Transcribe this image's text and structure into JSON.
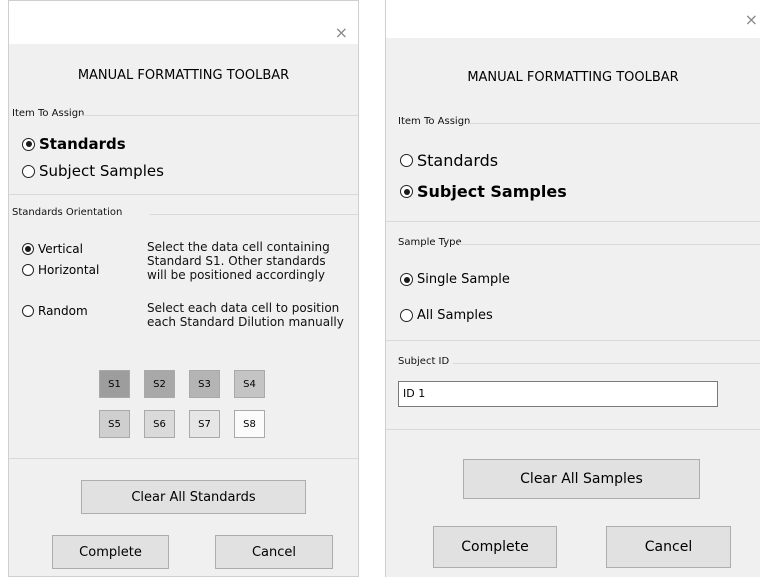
{
  "close_glyph": "×",
  "left": {
    "title": "MANUAL FORMATTING TOOLBAR",
    "item_group_label": "Item To Assign",
    "item_options": [
      {
        "label": "Standards",
        "selected": true
      },
      {
        "label": "Subject Samples",
        "selected": false
      }
    ],
    "orientation_group_label": "Standards Orientation",
    "orientation_options": [
      {
        "label": "Vertical",
        "selected": true
      },
      {
        "label": "Horizontal",
        "selected": false
      },
      {
        "label": "Random",
        "selected": false
      }
    ],
    "orientation_desc_1": [
      "Select the data cell containing",
      "Standard S1. Other standards",
      "will be positioned accordingly"
    ],
    "orientation_desc_2": [
      "Select each data cell to position",
      "each Standard Dilution manually"
    ],
    "standards": [
      {
        "label": "S1",
        "color": "#9d9d9d"
      },
      {
        "label": "S2",
        "color": "#a8a8a8"
      },
      {
        "label": "S3",
        "color": "#b4b4b4"
      },
      {
        "label": "S4",
        "color": "#c4c4c4"
      },
      {
        "label": "S5",
        "color": "#cfcfcf"
      },
      {
        "label": "S6",
        "color": "#dadada"
      },
      {
        "label": "S7",
        "color": "#e6e6e6"
      },
      {
        "label": "S8",
        "color": "#fbfbfb"
      }
    ],
    "clear_label": "Clear All Standards",
    "complete_label": "Complete",
    "cancel_label": "Cancel"
  },
  "right": {
    "title": "MANUAL FORMATTING TOOLBAR",
    "item_group_label": "Item To Assign",
    "item_options": [
      {
        "label": "Standards",
        "selected": false
      },
      {
        "label": "Subject Samples",
        "selected": true
      }
    ],
    "sample_type_label": "Sample Type",
    "sample_type_options": [
      {
        "label": "Single Sample",
        "selected": true
      },
      {
        "label": "All Samples",
        "selected": false
      }
    ],
    "subject_id_label": "Subject ID",
    "subject_id_value": "ID 1",
    "clear_label": "Clear All Samples",
    "complete_label": "Complete",
    "cancel_label": "Cancel"
  }
}
